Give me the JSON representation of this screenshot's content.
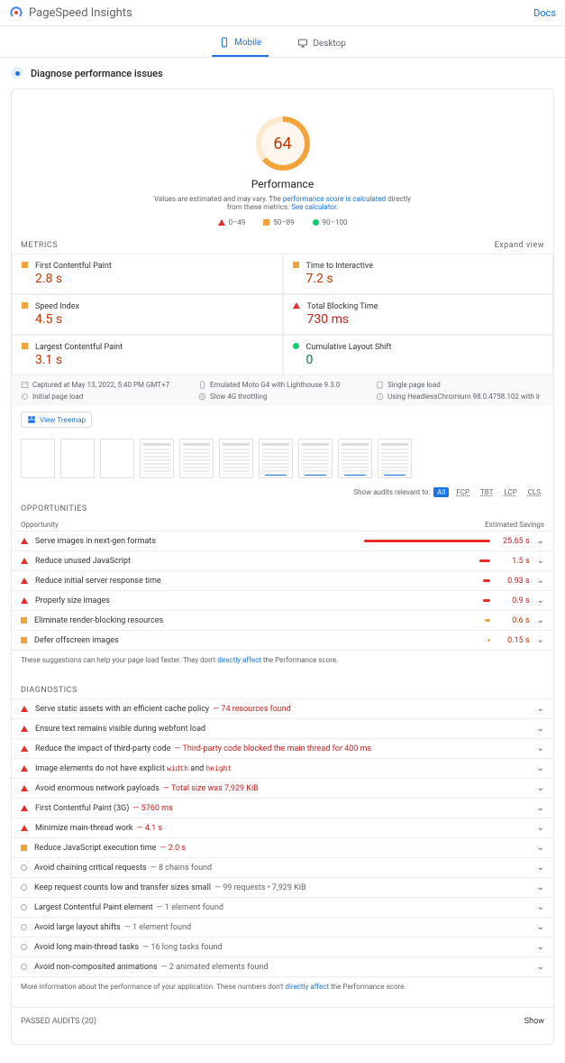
{
  "header": {
    "brand": "PageSpeed Insights",
    "docs": "Docs"
  },
  "tabs": {
    "mobile": "Mobile",
    "desktop": "Desktop"
  },
  "diagnose": "Diagnose performance issues",
  "gauge": {
    "score": "64",
    "label": "Performance",
    "note1": "Values are estimated and may vary. The ",
    "note_link1": "performance score is calculated",
    "note2": " directly from these metrics. ",
    "note_link2": "See calculator."
  },
  "legend": {
    "low": "0–49",
    "mid": "50–89",
    "high": "90–100"
  },
  "section": {
    "metrics": "METRICS",
    "expand": "Expand view",
    "opportunities": "OPPORTUNITIES",
    "diagnostics": "DIAGNOSTICS",
    "passed": "PASSED AUDITS (20)",
    "show": "Show"
  },
  "metrics": [
    {
      "name": "First Contentful Paint",
      "value": "2.8 s",
      "status": "orange"
    },
    {
      "name": "Time to Interactive",
      "value": "7.2 s",
      "status": "orange"
    },
    {
      "name": "Speed Index",
      "value": "4.5 s",
      "status": "orange"
    },
    {
      "name": "Total Blocking Time",
      "value": "730 ms",
      "status": "red"
    },
    {
      "name": "Largest Contentful Paint",
      "value": "3.1 s",
      "status": "orange"
    },
    {
      "name": "Cumulative Layout Shift",
      "value": "0",
      "status": "green"
    }
  ],
  "capture": {
    "c0": "Captured at May 13, 2022, 5:40 PM GMT+7",
    "c1": "Emulated Moto G4 with Lighthouse 9.3.0",
    "c2": "Single page load",
    "c3": "Initial page load",
    "c4": "Slow 4G throttling",
    "c5": "Using HeadlessChromium 98.0.4758.102 with lr"
  },
  "treemap": "View Treemap",
  "filter": {
    "label": "Show audits relevant to:",
    "all": "All",
    "fcp": "FCP",
    "tbt": "TBT",
    "lcp": "LCP",
    "cls": "CLS"
  },
  "opp_head": {
    "left": "Opportunity",
    "right": "Estimated Savings"
  },
  "opportunities": [
    {
      "name": "Serve images in next-gen formats",
      "save": "25.65 s",
      "bar": 140,
      "status": "red"
    },
    {
      "name": "Reduce unused JavaScript",
      "save": "1.5 s",
      "bar": 12,
      "status": "red"
    },
    {
      "name": "Reduce initial server response time",
      "save": "0.93 s",
      "bar": 8,
      "status": "red"
    },
    {
      "name": "Properly size images",
      "save": "0.9 s",
      "bar": 8,
      "status": "red"
    },
    {
      "name": "Eliminate render-blocking resources",
      "save": "0.6 s",
      "bar": 6,
      "status": "orange"
    },
    {
      "name": "Defer offscreen images",
      "save": "0.15 s",
      "bar": 3,
      "status": "orange"
    }
  ],
  "opp_foot": {
    "t1": "These suggestions can help your page load faster. They don't ",
    "link": "directly affect",
    "t2": " the Performance score."
  },
  "diagnostics": [
    {
      "status": "red",
      "name": "Serve static assets with an efficient cache policy",
      "detail": "— 74 resources found",
      "dclass": "red"
    },
    {
      "status": "red",
      "name": "Ensure text remains visible during webfont load",
      "detail": "",
      "dclass": ""
    },
    {
      "status": "red",
      "name": "Reduce the impact of third-party code",
      "detail": "— Third-party code blocked the main thread for 400 ms",
      "dclass": "red"
    },
    {
      "status": "red",
      "name": "Image elements do not have explicit",
      "detail": "",
      "dclass": "",
      "mono": true
    },
    {
      "status": "red",
      "name": "Avoid enormous network payloads",
      "detail": "— Total size was 7,929 KiB",
      "dclass": "red"
    },
    {
      "status": "red",
      "name": "First Contentful Paint (3G)",
      "detail": "— 5760 ms",
      "dclass": "red"
    },
    {
      "status": "red",
      "name": "Minimize main-thread work",
      "detail": "— 4.1 s",
      "dclass": "red"
    },
    {
      "status": "orange",
      "name": "Reduce JavaScript execution time",
      "detail": "— 2.0 s",
      "dclass": "red"
    },
    {
      "status": "gray",
      "name": "Avoid chaining critical requests",
      "detail": "— 8 chains found",
      "dclass": "gray"
    },
    {
      "status": "gray",
      "name": "Keep request counts low and transfer sizes small",
      "detail": "— 99 requests • 7,929 KiB",
      "dclass": "gray"
    },
    {
      "status": "gray",
      "name": "Largest Contentful Paint element",
      "detail": "— 1 element found",
      "dclass": "gray"
    },
    {
      "status": "gray",
      "name": "Avoid large layout shifts",
      "detail": "— 1 element found",
      "dclass": "gray"
    },
    {
      "status": "gray",
      "name": "Avoid long main-thread tasks",
      "detail": "— 16 long tasks found",
      "dclass": "gray"
    },
    {
      "status": "gray",
      "name": "Avoid non-composited animations",
      "detail": "— 2 animated elements found",
      "dclass": "gray"
    }
  ],
  "diag_mono": {
    "width": "width",
    "and": " and ",
    "height": "height"
  },
  "diag_foot": {
    "t1": "More information about the performance of your application. These numbers don't ",
    "link": "directly affect",
    "t2": " the Performance score."
  }
}
